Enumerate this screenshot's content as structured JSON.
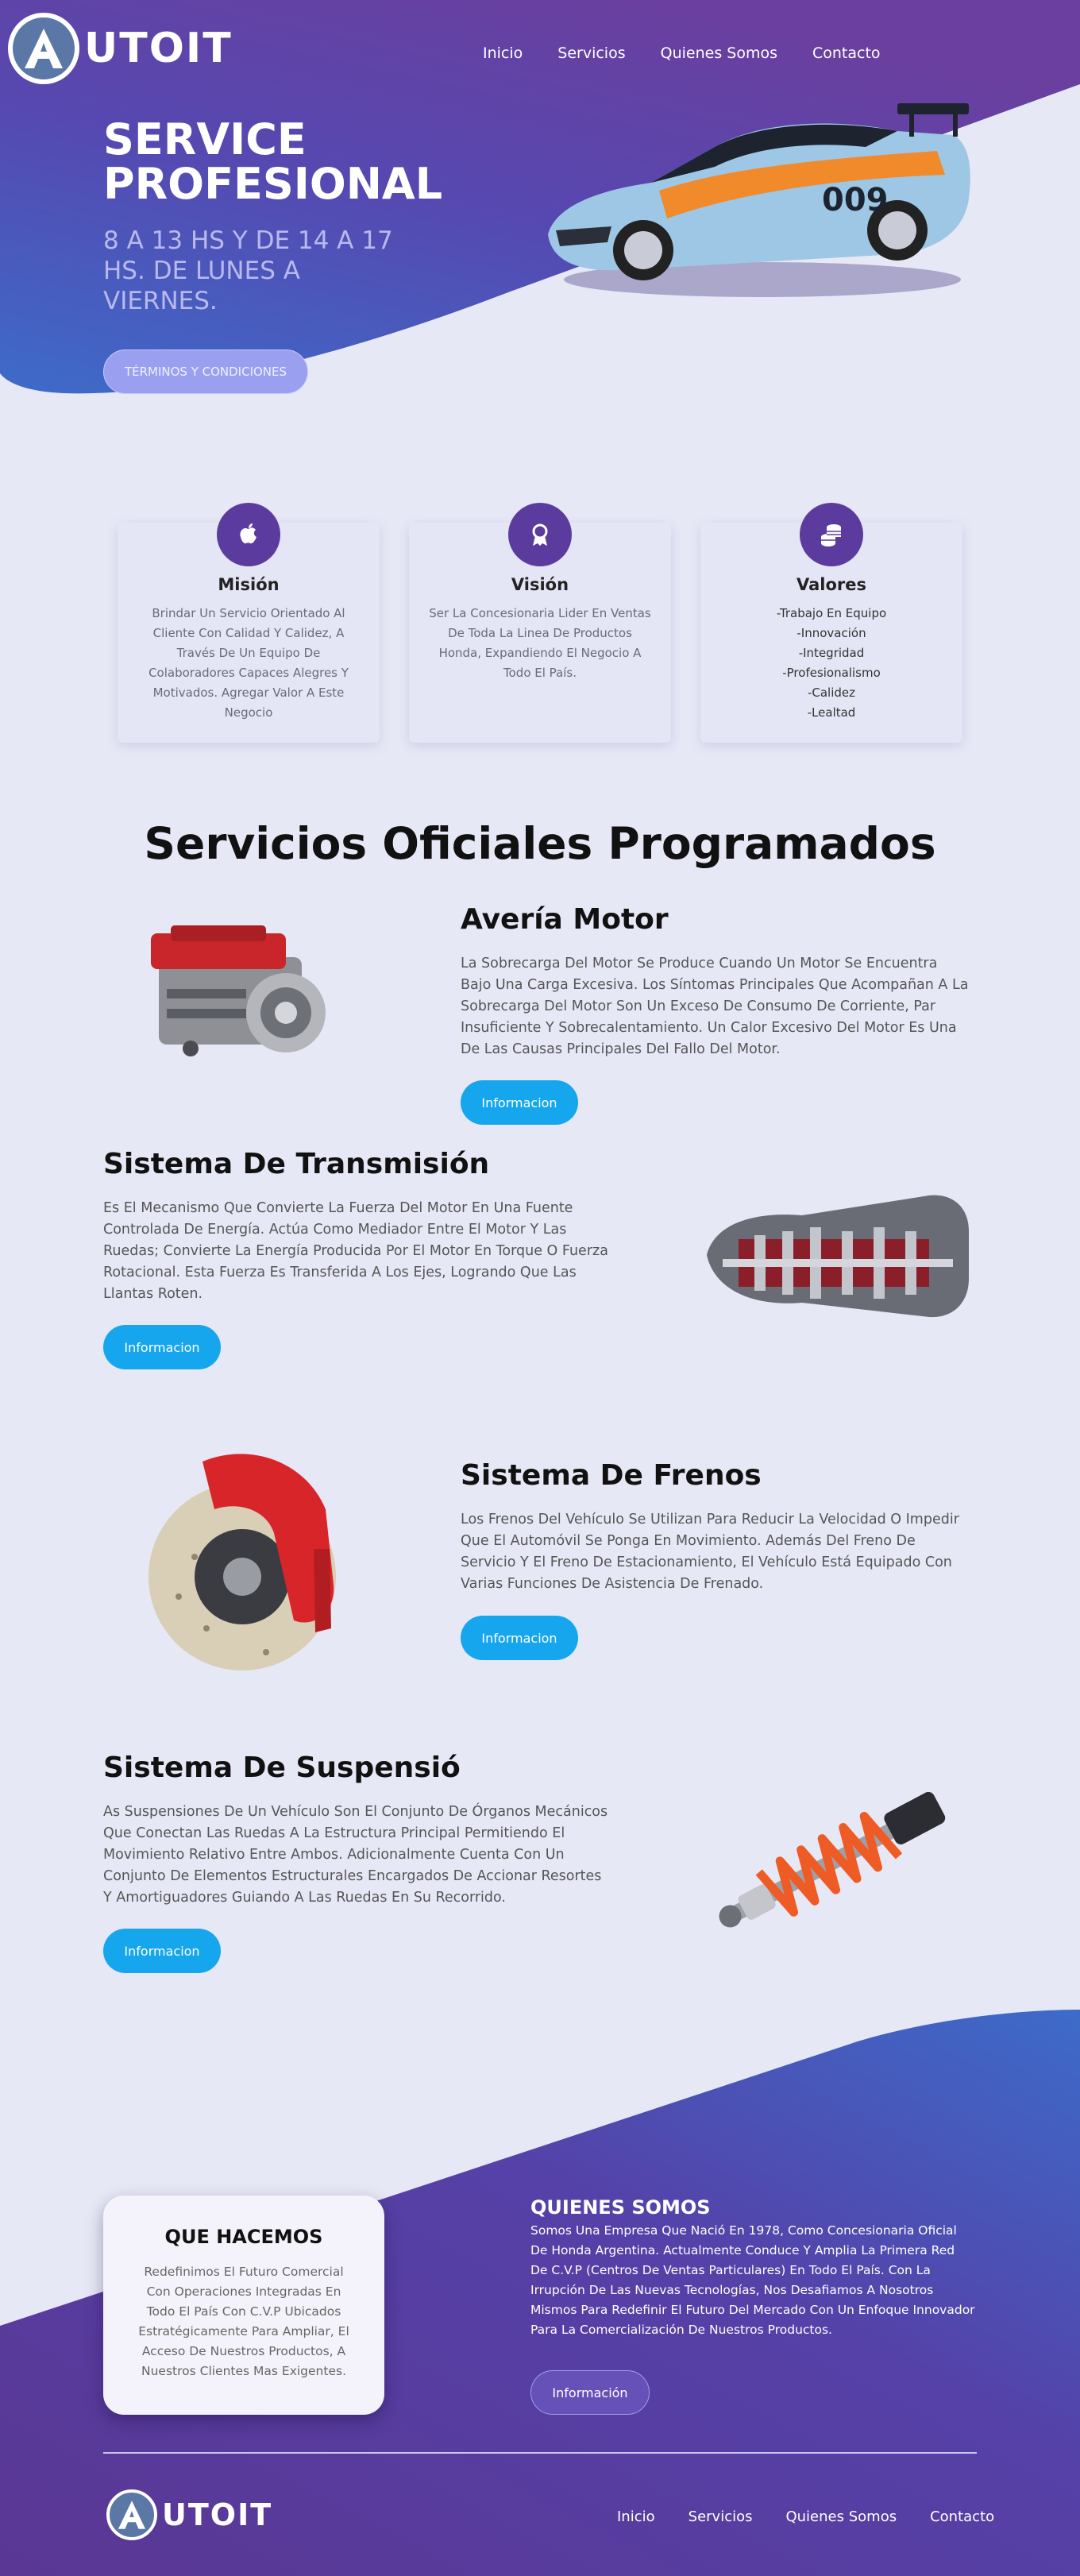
{
  "brand": {
    "logo_text": "UTOIT"
  },
  "nav": [
    "Inicio",
    "Servicios",
    "Quienes Somos",
    "Contacto"
  ],
  "hero": {
    "title": "SERVICE PROFESIONAL",
    "subtitle": "8 A 13 HS Y DE 14 A 17 HS. DE LUNES A VIERNES.",
    "button": "TÉRMINOS Y CONDICIONES"
  },
  "cards": [
    {
      "icon": "apple-icon",
      "title": "Misión",
      "text": "Brindar Un Servicio Orientado Al Cliente Con Calidad Y Calidez, A Través De Un Equipo De Colaboradores Capaces Alegres Y Motivados. Agregar Valor A Este Negocio"
    },
    {
      "icon": "award-icon",
      "title": "Visión",
      "text": "Ser La Concesionaria Lider En Ventas De Toda La Linea De Productos Honda, Expandiendo El Negocio A Todo El País."
    },
    {
      "icon": "coins-icon",
      "title": "Valores",
      "items": [
        "-Trabajo En Equipo",
        "-Innovación",
        "-Integridad",
        "-Profesionalismo",
        "-Calidez",
        "-Lealtad"
      ]
    }
  ],
  "services": {
    "heading": "Servicios Oficiales Programados",
    "items": [
      {
        "title": "Avería Motor",
        "text": "La Sobrecarga Del Motor Se Produce Cuando Un Motor Se Encuentra Bajo Una Carga Excesiva. Los Síntomas Principales Que Acompañan A La Sobrecarga Del Motor Son Un Exceso De Consumo De Corriente, Par Insuficiente Y Sobrecalentamiento. Un Calor Excesivo Del Motor Es Una De Las Causas Principales Del Fallo Del Motor.",
        "button": "Informacion"
      },
      {
        "title": "Sistema De Transmisión",
        "text": "Es El Mecanismo Que Convierte La Fuerza Del Motor En Una Fuente Controlada De Energía. Actúa Como Mediador Entre El Motor Y Las Ruedas; Convierte La Energía Producida Por El Motor En Torque O Fuerza Rotacional. Esta Fuerza Es Transferida A Los Ejes, Logrando Que Las Llantas Roten.",
        "button": "Informacion"
      },
      {
        "title": "Sistema De Frenos",
        "text": "Los Frenos Del Vehículo Se Utilizan Para Reducir La Velocidad O Impedir Que El Automóvil Se Ponga En Movimiento. Además Del Freno De Servicio Y El Freno De Estacionamiento, El Vehículo Está Equipado Con Varias Funciones De Asistencia De Frenado.",
        "button": "Informacion"
      },
      {
        "title": "Sistema De Suspensió",
        "text": "As Suspensiones De Un Vehículo Son El Conjunto De Órganos Mecánicos Que Conectan Las Ruedas A La Estructura Principal Permitiendo El Movimiento Relativo Entre Ambos. Adicionalmente Cuenta Con Un Conjunto De Elementos Estructurales Encargados De Accionar Resortes Y Amortiguadores Guiando A Las Ruedas En Su Recorrido.",
        "button": "Informacion"
      }
    ]
  },
  "about": {
    "card_title": "QUE HACEMOS",
    "card_text": "Redefinimos El Futuro Comercial Con Operaciones Integradas En Todo El País Con C.V.P Ubicados Estratégicamente Para Ampliar, El Acceso De Nuestros Productos, A Nuestros Clientes Mas Exigentes.",
    "title": "QUIENES SOMOS",
    "text": "Somos Una Empresa Que Nació En 1978, Como Concesionaria Oficial De Honda Argentina. Actualmente Conduce Y Amplia La Primera Red De C.V.P (Centros De Ventas Particulares) En Todo El País. Con La Irrupción De Las Nuevas Tecnologías, Nos Desafiamos A Nosotros Mismos Para Redefinir El Futuro Del Mercado Con Un Enfoque Innovador Para La Comercialización De Nuestros Productos.",
    "button": "Información"
  },
  "colors": {
    "purple": "#5b3b9d",
    "blue": "#4469c4",
    "accent": "#16a6ee",
    "background": "#e7e8f6"
  }
}
